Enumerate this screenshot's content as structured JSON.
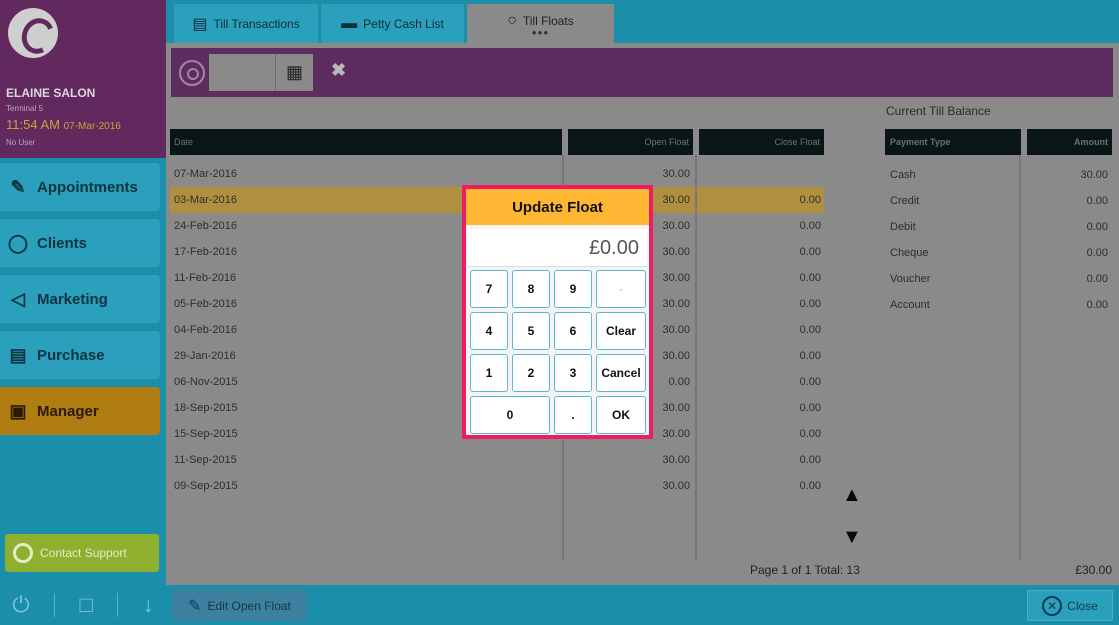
{
  "sidebar": {
    "salon_name": "ELAINE SALON",
    "terminal": "Terminal 5",
    "time": "11:54 AM",
    "date": "07-Mar-2016",
    "user": "No User",
    "nav": [
      {
        "label": "Appointments",
        "icon": "calendar-edit-icon"
      },
      {
        "label": "Clients",
        "icon": "person-head-icon"
      },
      {
        "label": "Marketing",
        "icon": "megaphone-icon"
      },
      {
        "label": "Purchase",
        "icon": "shopping-cart-icon"
      },
      {
        "label": "Manager",
        "icon": "briefcase-icon",
        "active": true
      }
    ],
    "support_label": "Contact Support"
  },
  "tabs": [
    {
      "label": "Till Transactions",
      "icon": "cash-register-icon"
    },
    {
      "label": "Petty Cash List",
      "icon": "cash-box-icon"
    },
    {
      "label": "Till Floats",
      "icon": "coins-icon",
      "active": true
    }
  ],
  "table": {
    "headers": [
      "Date",
      "Open Float",
      "Close Float"
    ],
    "rows": [
      {
        "date": "07-Mar-2016",
        "open": "30.00",
        "close": ""
      },
      {
        "date": "03-Mar-2016",
        "open": "30.00",
        "close": "0.00",
        "selected": true
      },
      {
        "date": "24-Feb-2016",
        "open": "30.00",
        "close": "0.00"
      },
      {
        "date": "17-Feb-2016",
        "open": "30.00",
        "close": "0.00"
      },
      {
        "date": "11-Feb-2016",
        "open": "30.00",
        "close": "0.00"
      },
      {
        "date": "05-Feb-2016",
        "open": "30.00",
        "close": "0.00"
      },
      {
        "date": "04-Feb-2016",
        "open": "30.00",
        "close": "0.00"
      },
      {
        "date": "29-Jan-2016",
        "open": "30.00",
        "close": "0.00"
      },
      {
        "date": "06-Nov-2015",
        "open": "0.00",
        "close": "0.00"
      },
      {
        "date": "18-Sep-2015",
        "open": "30.00",
        "close": "0.00"
      },
      {
        "date": "15-Sep-2015",
        "open": "30.00",
        "close": "0.00"
      },
      {
        "date": "11-Sep-2015",
        "open": "30.00",
        "close": "0.00"
      },
      {
        "date": "09-Sep-2015",
        "open": "30.00",
        "close": "0.00"
      }
    ],
    "pager": "Page 1 of 1  Total: 13"
  },
  "balance": {
    "title": "Current Till Balance",
    "headers": [
      "Payment Type",
      "Amount"
    ],
    "rows": [
      {
        "type": "Cash",
        "amount": "30.00"
      },
      {
        "type": "Credit",
        "amount": "0.00"
      },
      {
        "type": "Debit",
        "amount": "0.00"
      },
      {
        "type": "Cheque",
        "amount": "0.00"
      },
      {
        "type": "Voucher",
        "amount": "0.00"
      },
      {
        "type": "Account",
        "amount": "0.00"
      }
    ],
    "total": "£30.00"
  },
  "footer": {
    "edit_label": "Edit Open Float",
    "close_label": "Close"
  },
  "dialog": {
    "title": "Update Float",
    "value": "£0.00",
    "keys": {
      "k7": "7",
      "k8": "8",
      "k9": "9",
      "kdash": "-",
      "k4": "4",
      "k5": "5",
      "k6": "6",
      "clear": "Clear",
      "k1": "1",
      "k2": "2",
      "k3": "3",
      "cancel": "Cancel",
      "k0": "0",
      "dot": ".",
      "ok": "OK"
    }
  },
  "colors": {
    "accent": "#1b8ea9",
    "purple": "#62295f",
    "highlight": "#ee1c60",
    "dialog_title": "#ffb733"
  }
}
